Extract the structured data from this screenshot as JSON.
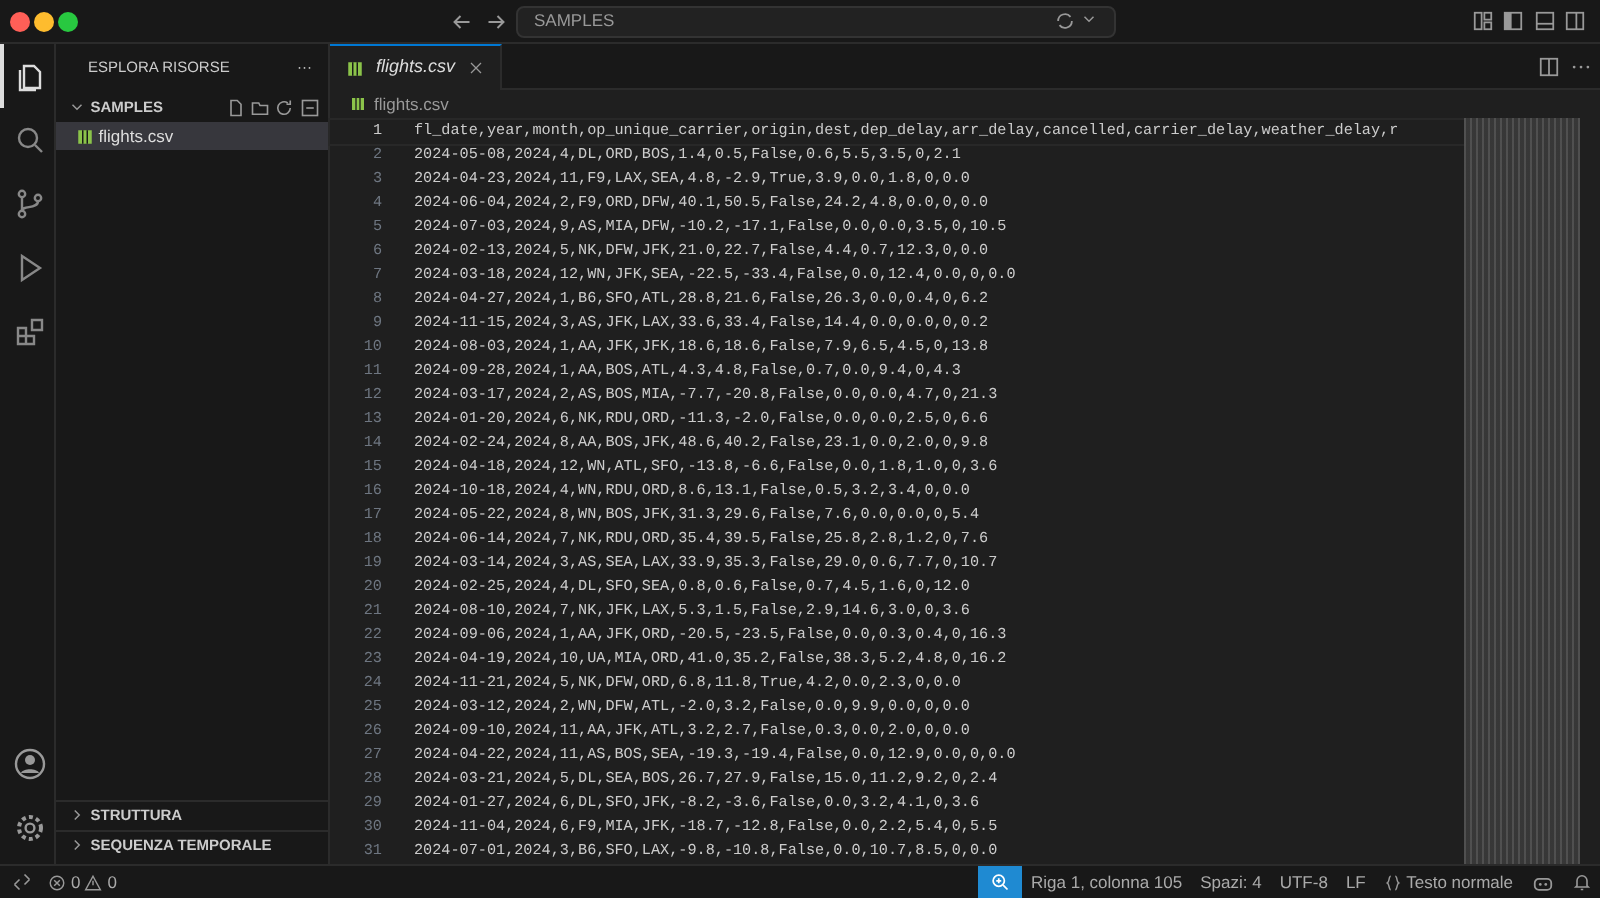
{
  "window": {
    "search": "SAMPLES"
  },
  "activity_bar": [
    {
      "kind": "files",
      "selected": true
    },
    {
      "kind": "search",
      "selected": false
    },
    {
      "kind": "branch",
      "selected": false
    },
    {
      "kind": "run",
      "selected": false
    },
    {
      "kind": "blocks",
      "selected": false
    }
  ],
  "sidebar": {
    "title": "ESPLORA RISORSE",
    "more": "···",
    "folder": {
      "name": "SAMPLES",
      "expanded": true,
      "files": [
        {
          "name": "flights.csv",
          "selected": true
        }
      ]
    },
    "sections": [
      {
        "name": "STRUTTURA",
        "expanded": false
      },
      {
        "name": "SEQUENZA TEMPORALE",
        "expanded": false
      }
    ]
  },
  "tabs": [
    {
      "label": "flights.csv",
      "selected": true
    }
  ],
  "breadcrumb": "flights.csv",
  "editor": {
    "lines": [
      {
        "number": "1",
        "text": "fl_date,year,month,op_unique_carrier,origin,dest,dep_delay,arr_delay,cancelled,carrier_delay,weather_delay,r"
      },
      {
        "number": "2",
        "text": "2024-05-08,2024,4,DL,ORD,BOS,1.4,0.5,False,0.6,5.5,3.5,0,2.1"
      },
      {
        "number": "3",
        "text": "2024-04-23,2024,11,F9,LAX,SEA,4.8,-2.9,True,3.9,0.0,1.8,0,0.0"
      },
      {
        "number": "4",
        "text": "2024-06-04,2024,2,F9,ORD,DFW,40.1,50.5,False,24.2,4.8,0.0,0,0.0"
      },
      {
        "number": "5",
        "text": "2024-07-03,2024,9,AS,MIA,DFW,-10.2,-17.1,False,0.0,0.0,3.5,0,10.5"
      },
      {
        "number": "6",
        "text": "2024-02-13,2024,5,NK,DFW,JFK,21.0,22.7,False,4.4,0.7,12.3,0,0.0"
      },
      {
        "number": "7",
        "text": "2024-03-18,2024,12,WN,JFK,SEA,-22.5,-33.4,False,0.0,12.4,0.0,0,0.0"
      },
      {
        "number": "8",
        "text": "2024-04-27,2024,1,B6,SFO,ATL,28.8,21.6,False,26.3,0.0,0.4,0,6.2"
      },
      {
        "number": "9",
        "text": "2024-11-15,2024,3,AS,JFK,LAX,33.6,33.4,False,14.4,0.0,0.0,0,0.2"
      },
      {
        "number": "10",
        "text": "2024-08-03,2024,1,AA,JFK,JFK,18.6,18.6,False,7.9,6.5,4.5,0,13.8"
      },
      {
        "number": "11",
        "text": "2024-09-28,2024,1,AA,BOS,ATL,4.3,4.8,False,0.7,0.0,9.4,0,4.3"
      },
      {
        "number": "12",
        "text": "2024-03-17,2024,2,AS,BOS,MIA,-7.7,-20.8,False,0.0,0.0,4.7,0,21.3"
      },
      {
        "number": "13",
        "text": "2024-01-20,2024,6,NK,RDU,ORD,-11.3,-2.0,False,0.0,0.0,2.5,0,6.6"
      },
      {
        "number": "14",
        "text": "2024-02-24,2024,8,AA,BOS,JFK,48.6,40.2,False,23.1,0.0,2.0,0,9.8"
      },
      {
        "number": "15",
        "text": "2024-04-18,2024,12,WN,ATL,SFO,-13.8,-6.6,False,0.0,1.8,1.0,0,3.6"
      },
      {
        "number": "16",
        "text": "2024-10-18,2024,4,WN,RDU,ORD,8.6,13.1,False,0.5,3.2,3.4,0,0.0"
      },
      {
        "number": "17",
        "text": "2024-05-22,2024,8,WN,BOS,JFK,31.3,29.6,False,7.6,0.0,0.0,0,5.4"
      },
      {
        "number": "18",
        "text": "2024-06-14,2024,7,NK,RDU,ORD,35.4,39.5,False,25.8,2.8,1.2,0,7.6"
      },
      {
        "number": "19",
        "text": "2024-03-14,2024,3,AS,SEA,LAX,33.9,35.3,False,29.0,0.6,7.7,0,10.7"
      },
      {
        "number": "20",
        "text": "2024-02-25,2024,4,DL,SFO,SEA,0.8,0.6,False,0.7,4.5,1.6,0,12.0"
      },
      {
        "number": "21",
        "text": "2024-08-10,2024,7,NK,JFK,LAX,5.3,1.5,False,2.9,14.6,3.0,0,3.6"
      },
      {
        "number": "22",
        "text": "2024-09-06,2024,1,AA,JFK,ORD,-20.5,-23.5,False,0.0,0.3,0.4,0,16.3"
      },
      {
        "number": "23",
        "text": "2024-04-19,2024,10,UA,MIA,ORD,41.0,35.2,False,38.3,5.2,4.8,0,16.2"
      },
      {
        "number": "24",
        "text": "2024-11-21,2024,5,NK,DFW,ORD,6.8,11.8,True,4.2,0.0,2.3,0,0.0"
      },
      {
        "number": "25",
        "text": "2024-03-12,2024,2,WN,DFW,ATL,-2.0,3.2,False,0.0,9.9,0.0,0,0.0"
      },
      {
        "number": "26",
        "text": "2024-09-10,2024,11,AA,JFK,ATL,3.2,2.7,False,0.3,0.0,2.0,0,0.0"
      },
      {
        "number": "27",
        "text": "2024-04-22,2024,11,AS,BOS,SEA,-19.3,-19.4,False,0.0,12.9,0.0,0,0.0"
      },
      {
        "number": "28",
        "text": "2024-03-21,2024,5,DL,SEA,BOS,26.7,27.9,False,15.0,11.2,9.2,0,2.4"
      },
      {
        "number": "29",
        "text": "2024-01-27,2024,6,DL,SFO,JFK,-8.2,-3.6,False,0.0,3.2,4.1,0,3.6"
      },
      {
        "number": "30",
        "text": "2024-11-04,2024,6,F9,MIA,JFK,-18.7,-12.8,False,0.0,2.2,5.4,0,5.5"
      },
      {
        "number": "31",
        "text": "2024-07-01,2024,3,B6,SFO,LAX,-9.8,-10.8,False,0.0,10.7,8.5,0,0.0"
      }
    ]
  },
  "status_bar": {
    "errors": "0",
    "warnings": "0",
    "position": "Riga 1, colonna 105",
    "indent": "Spazi: 4",
    "encoding": "UTF-8",
    "eol": "LF",
    "language": "Testo normale"
  }
}
